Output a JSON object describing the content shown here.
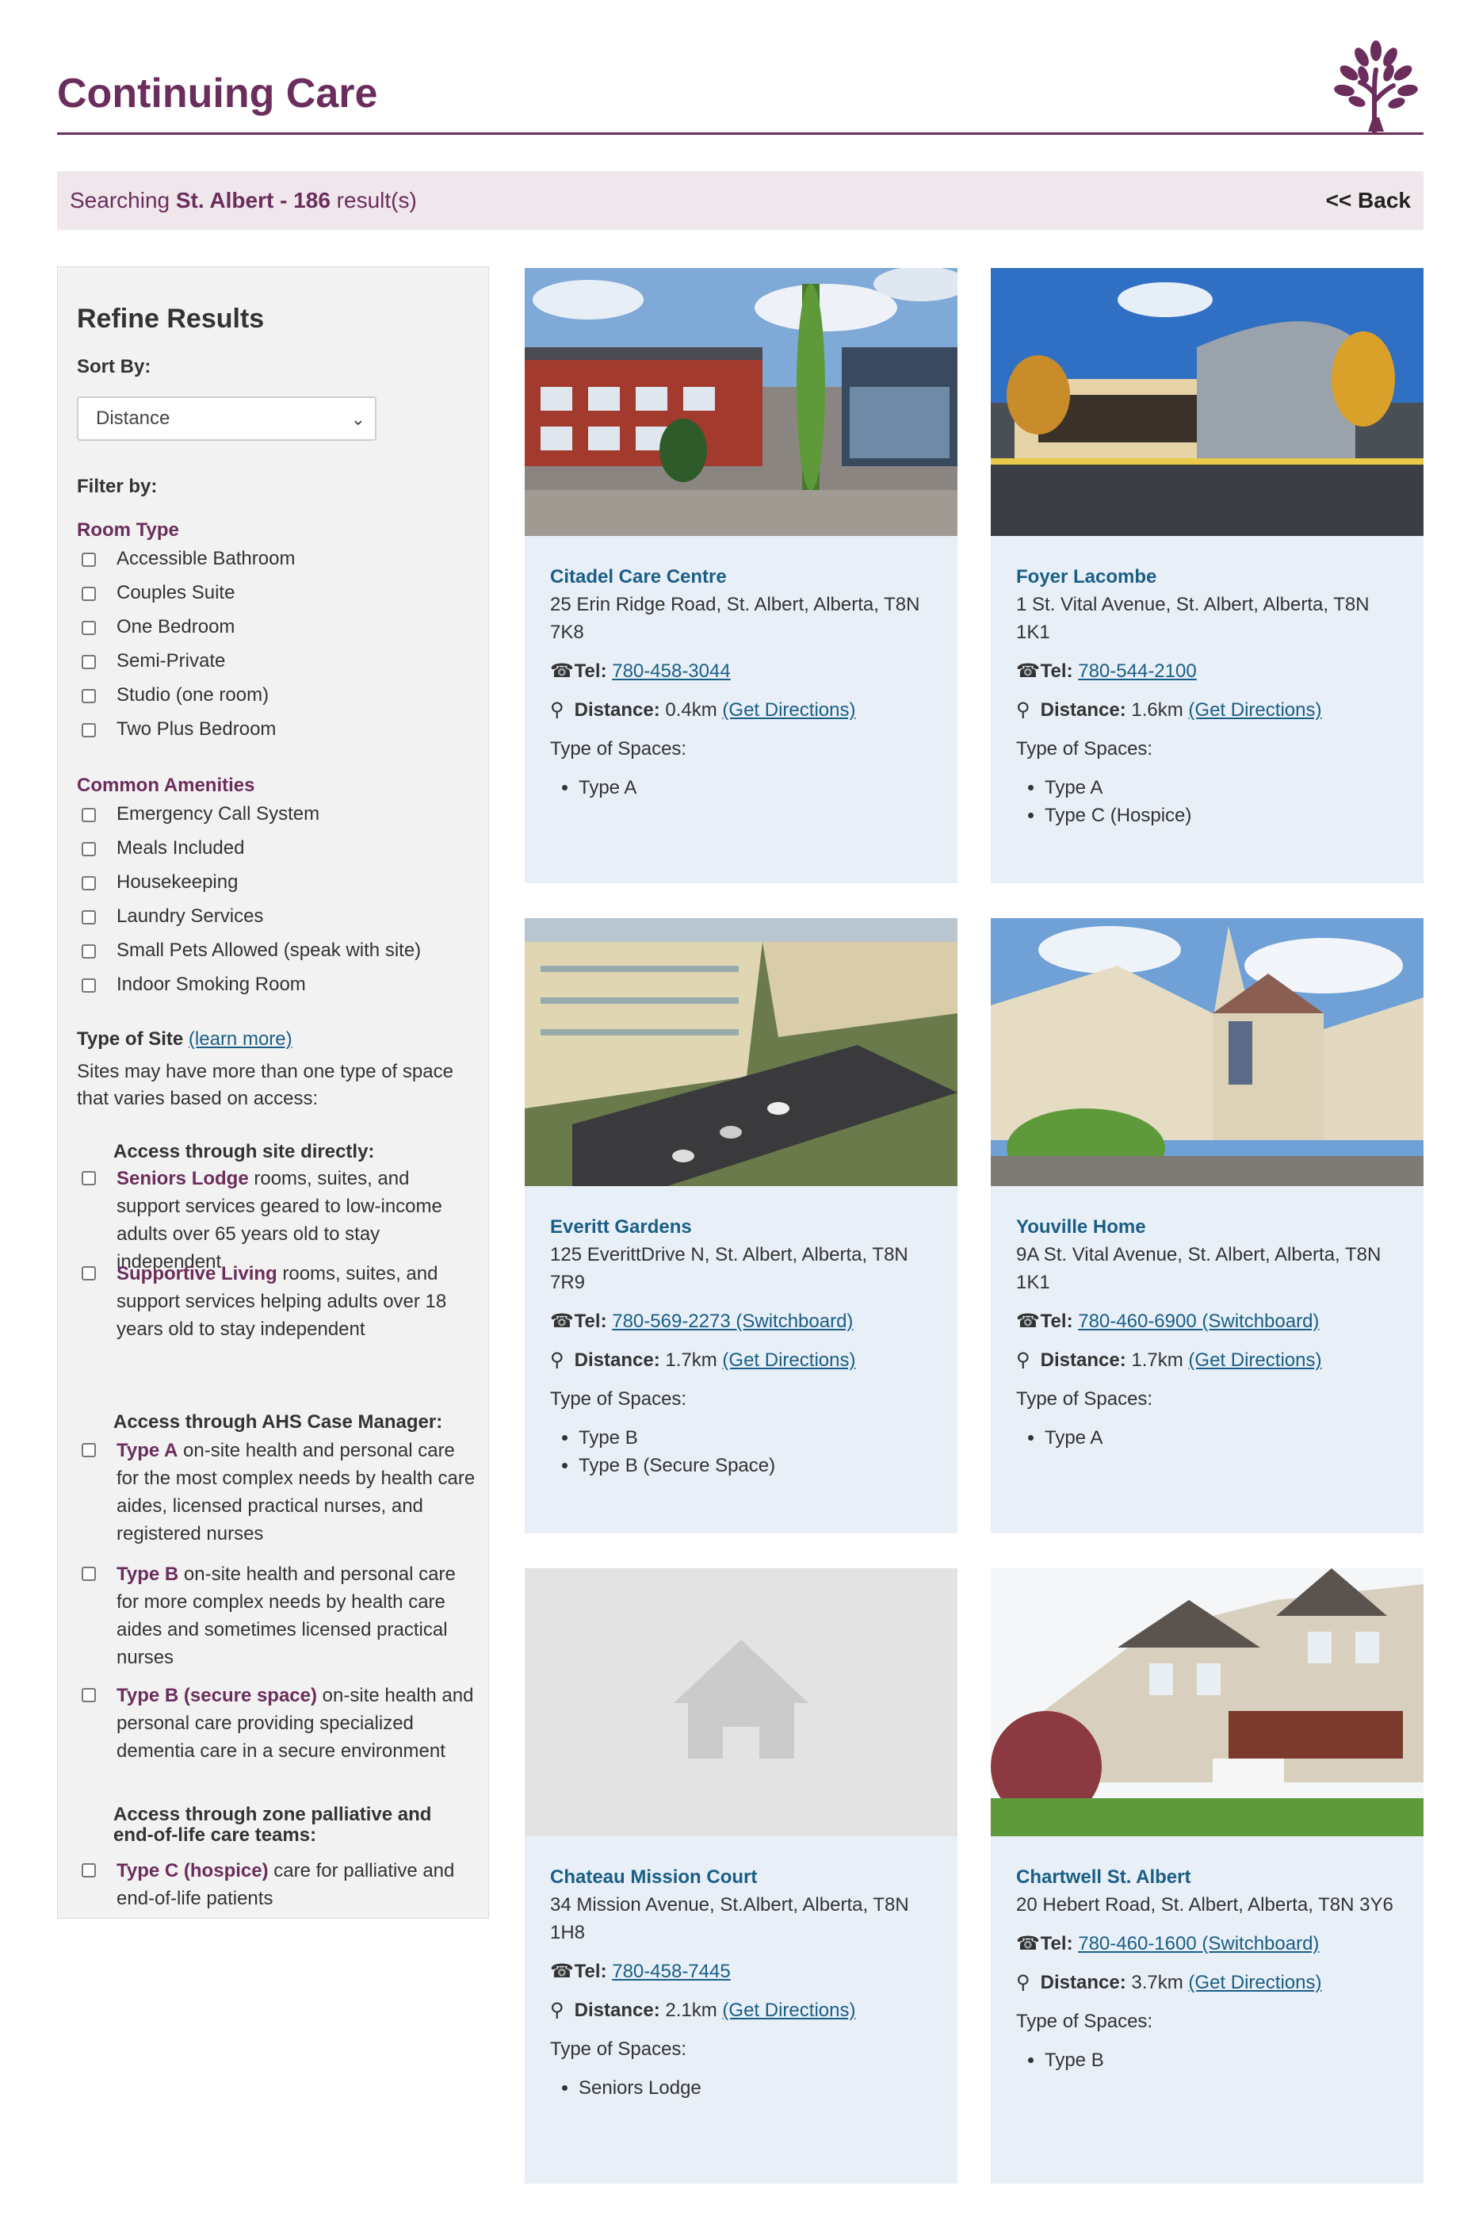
{
  "header": {
    "title": "Continuing Care",
    "logo": "tree-icon"
  },
  "search": {
    "prefix": "Searching ",
    "location": "St. Albert - 186",
    "suffix": " result(s)",
    "back": "<< Back"
  },
  "sidebar": {
    "title": "Refine Results",
    "sort_label": "Sort By:",
    "sort_value": "Distance",
    "filter_label": "Filter by:",
    "room_type": {
      "title": "Room Type",
      "options": [
        "Accessible Bathroom",
        "Couples Suite",
        "One Bedroom",
        "Semi-Private",
        "Studio (one room)",
        "Two Plus Bedroom"
      ]
    },
    "amenities": {
      "title": "Common Amenities",
      "options": [
        "Emergency Call System",
        "Meals Included",
        "Housekeeping",
        "Laundry Services",
        "Small Pets Allowed (speak with site)",
        "Indoor Smoking Room"
      ]
    },
    "site_type": {
      "title": "Type of Site",
      "learn_more": "(learn more)",
      "note": "Sites may have more than one type of space that varies based on access:",
      "direct_head": "Access through site directly:",
      "direct": [
        {
          "name": "Seniors Lodge",
          "desc": " rooms, suites, and support services geared to low-income adults over 65 years old to stay independent"
        },
        {
          "name": "Supportive Living",
          "desc": " rooms, suites, and support services helping adults over 18 years old to stay independent"
        }
      ],
      "ahs_head": "Access through AHS Case Manager:",
      "ahs": [
        {
          "name": "Type A",
          "desc": " on-site health and personal care for the most complex needs by health care aides, licensed practical nurses, and registered nurses"
        },
        {
          "name": "Type B",
          "desc": " on-site health and personal care for more complex needs by health care aides and sometimes licensed practical nurses"
        },
        {
          "name": "Type B (secure space)",
          "desc": " on-site health and personal care providing specialized dementia care in a secure environment"
        }
      ],
      "palliative_head": "Access through zone palliative and end-of-life care teams:",
      "palliative": [
        {
          "name": "Type C (hospice)",
          "desc": " care for palliative and end-of-life patients"
        }
      ]
    }
  },
  "labels": {
    "tel": "Tel:",
    "distance": "Distance:",
    "directions": "(Get Directions)",
    "types_label": "Type of Spaces:"
  },
  "results": [
    {
      "name": "Citadel Care Centre",
      "address": "25 Erin Ridge Road, St. Albert, Alberta, T8N 7K8",
      "tel": "780-458-3044",
      "distance": "0.4km",
      "types": [
        "Type A"
      ]
    },
    {
      "name": "Foyer Lacombe",
      "address": "1 St. Vital Avenue, St. Albert, Alberta, T8N 1K1",
      "tel": "780-544-2100",
      "distance": "1.6km",
      "types": [
        "Type A",
        "Type C (Hospice)"
      ]
    },
    {
      "name": "Everitt Gardens",
      "address": "125 EverittDrive N, St. Albert, Alberta, T8N 7R9",
      "tel": "780-569-2273 (Switchboard)",
      "distance": "1.7km",
      "types": [
        "Type B",
        "Type B (Secure Space)"
      ]
    },
    {
      "name": "Youville Home",
      "address": "9A St. Vital Avenue, St. Albert, Alberta, T8N 1K1",
      "tel": "780-460-6900 (Switchboard)",
      "distance": "1.7km",
      "types": [
        "Type A"
      ]
    },
    {
      "name": "Chateau Mission Court",
      "address": "34 Mission Avenue, St.Albert, Alberta, T8N 1H8",
      "tel": "780-458-7445",
      "distance": "2.1km",
      "types": [
        "Seniors Lodge"
      ]
    },
    {
      "name": "Chartwell St. Albert",
      "address": "20 Hebert Road, St. Albert, Alberta, T8N 3Y6",
      "tel": "780-460-1600 (Switchboard)",
      "distance": "3.7km",
      "types": [
        "Type B"
      ]
    }
  ],
  "colors": {
    "brand": "#6b2d5c",
    "link": "#1a5e86",
    "card_bg": "#e8eff7",
    "search_bg": "#efe7ec"
  }
}
